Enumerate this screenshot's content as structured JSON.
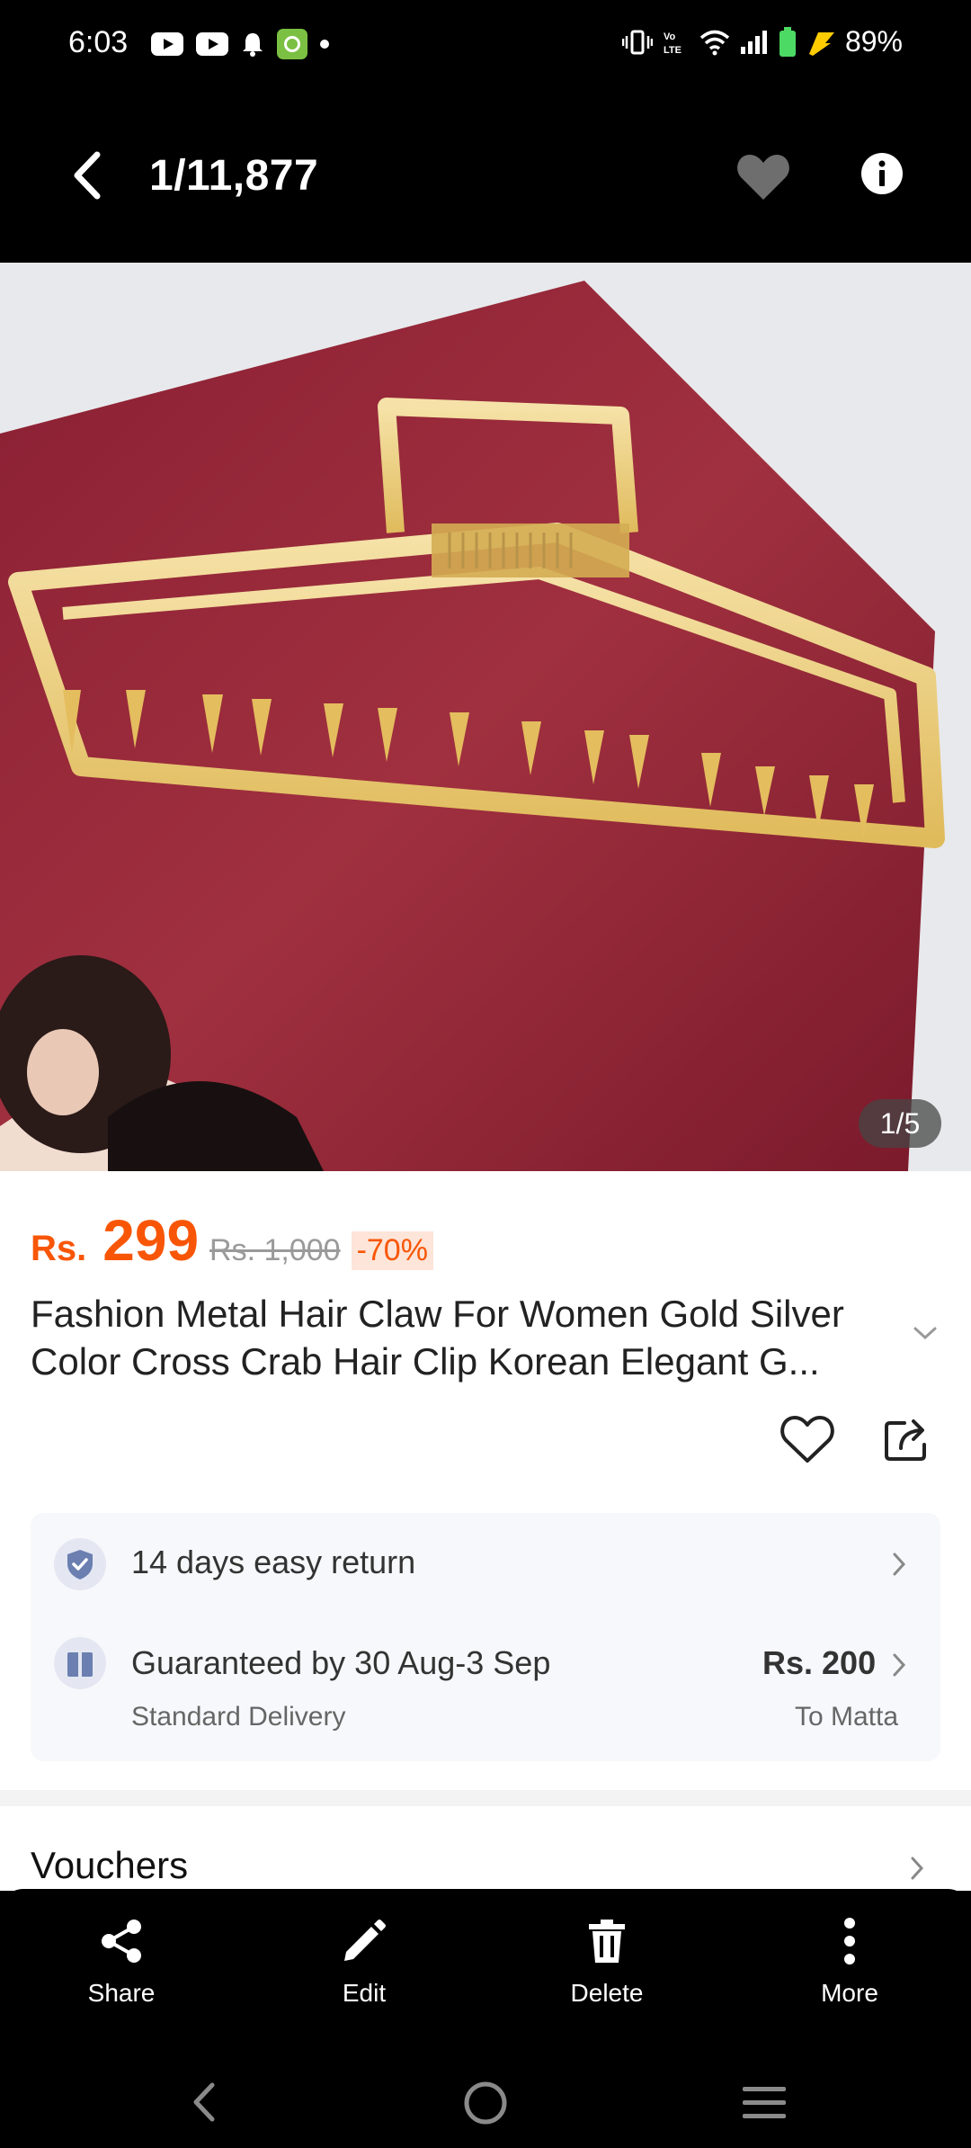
{
  "status_bar": {
    "time": "6:03",
    "battery": "89%"
  },
  "top_bar": {
    "counter": "1/11,877"
  },
  "image": {
    "counter": "1/5"
  },
  "product": {
    "currency": "Rs.",
    "price": "299",
    "original_price": "Rs. 1,000",
    "discount": "-70%",
    "title": "Fashion Metal Hair Claw For Women Gold Silver Color Cross Crab Hair Clip Korean Elegant G..."
  },
  "services": {
    "return_text": "14 days easy return",
    "delivery_text": "Guaranteed by 30 Aug-3 Sep",
    "delivery_sub": "Standard Delivery",
    "delivery_price": "Rs. 200",
    "delivery_location": "To Matta"
  },
  "vouchers": {
    "label": "Vouchers"
  },
  "actions": {
    "share": "Share",
    "edit": "Edit",
    "delete": "Delete",
    "more": "More"
  },
  "colors": {
    "accent": "#f85606",
    "badge_blue": "#6b7fb0"
  }
}
